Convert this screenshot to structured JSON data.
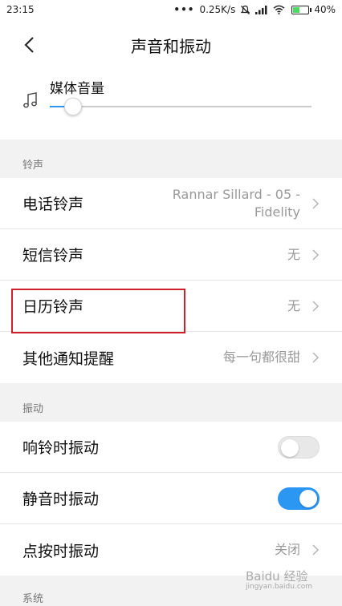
{
  "status_bar": {
    "time": "23:15",
    "network_speed": "0.25K/s",
    "battery": "40%",
    "battery_level": 0.4,
    "icons": [
      "more-dots-icon",
      "mute-icon",
      "signal-icon",
      "wifi-icon",
      "battery-icon"
    ]
  },
  "header": {
    "title": "声音和振动",
    "back_icon": "chevron-left-icon"
  },
  "media": {
    "label": "媒体音量",
    "icon": "music-note-icon",
    "volume_level": 0.09
  },
  "ringtones": {
    "section_label": "铃声",
    "items": [
      {
        "label": "电话铃声",
        "value": "Rannar Sillard - 05 - Fidelity"
      },
      {
        "label": "短信铃声",
        "value": "无"
      },
      {
        "label": "日历铃声",
        "value": "无"
      },
      {
        "label": "其他通知提醒",
        "value": "每一句都很甜"
      }
    ]
  },
  "vibration": {
    "section_label": "振动",
    "items": [
      {
        "label": "响铃时振动",
        "toggle": false
      },
      {
        "label": "静音时振动",
        "toggle": true
      },
      {
        "label": "点按时振动",
        "value": "关闭"
      }
    ]
  },
  "system": {
    "section_label": "系统"
  },
  "watermark": {
    "text": "Baidu 经验",
    "subtext": "jingyan.baidu.com"
  },
  "colors": {
    "accent": "#2c96f3",
    "highlight": "#d0202a",
    "background": "#f2f2f2"
  }
}
